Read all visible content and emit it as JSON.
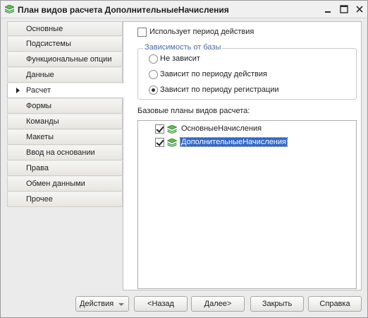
{
  "window": {
    "title": "План видов расчета ДополнительныеНачисления",
    "controls": [
      "minimize-icon",
      "maximize-icon",
      "close-icon"
    ]
  },
  "sidebar": {
    "items": [
      {
        "label": "Основные",
        "active": false
      },
      {
        "label": "Подсистемы",
        "active": false
      },
      {
        "label": "Функциональные опции",
        "active": false
      },
      {
        "label": "Данные",
        "active": false
      },
      {
        "label": "Расчет",
        "active": true
      },
      {
        "label": "Формы",
        "active": false
      },
      {
        "label": "Команды",
        "active": false
      },
      {
        "label": "Макеты",
        "active": false
      },
      {
        "label": "Ввод на основании",
        "active": false
      },
      {
        "label": "Права",
        "active": false
      },
      {
        "label": "Обмен данными",
        "active": false
      },
      {
        "label": "Прочее",
        "active": false
      }
    ]
  },
  "calc": {
    "uses_period_label": "Использует период действия",
    "uses_period_checked": false,
    "dependency": {
      "caption": "Зависимость от базы",
      "options": [
        {
          "label": "Не зависит",
          "selected": false
        },
        {
          "label": "Зависит по периоду действия",
          "selected": false
        },
        {
          "label": "Зависит по периоду регистрации",
          "selected": true
        }
      ]
    },
    "base_plans": {
      "label": "Базовые планы видов расчета:",
      "items": [
        {
          "label": "ОсновныеНачисления",
          "checked": true,
          "selected": false,
          "icon": "calc-plan-icon"
        },
        {
          "label": "ДополнительныеНачисления",
          "checked": true,
          "selected": true,
          "icon": "calc-plan-icon"
        }
      ]
    }
  },
  "footer": {
    "actions_label": "Действия",
    "back_label": "<Назад",
    "next_label": "Далее>",
    "close_label": "Закрыть",
    "help_label": "Справка"
  },
  "colors": {
    "accent_icon": "#3a9a3a",
    "selection": "#3168c7",
    "group_caption": "#4a6aa8"
  }
}
